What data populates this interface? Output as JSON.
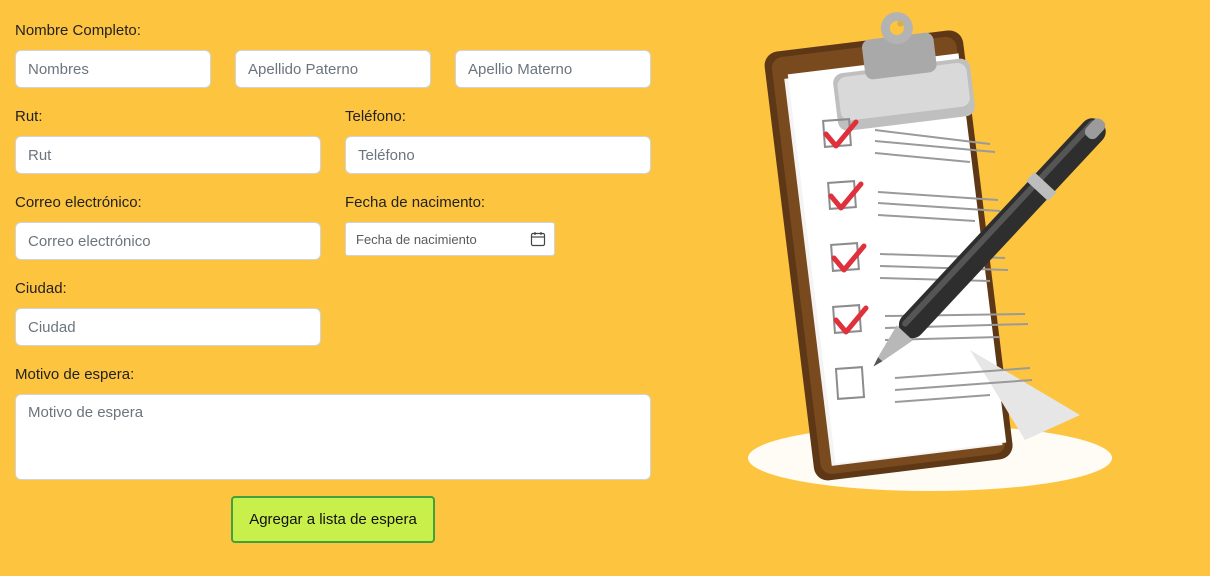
{
  "form": {
    "nombre_label": "Nombre Completo:",
    "nombres_placeholder": "Nombres",
    "apellido_paterno_placeholder": "Apellido Paterno",
    "apellido_materno_placeholder": "Apellio Materno",
    "rut_label": "Rut:",
    "rut_placeholder": "Rut",
    "telefono_label": "Teléfono:",
    "telefono_placeholder": "Teléfono",
    "correo_label": "Correo electrónico:",
    "correo_placeholder": "Correo electrónico",
    "fecha_label": "Fecha de nacimento:",
    "fecha_placeholder": "Fecha de nacimiento",
    "ciudad_label": "Ciudad:",
    "ciudad_placeholder": "Ciudad",
    "motivo_label": "Motivo de espera:",
    "motivo_placeholder": "Motivo de espera",
    "submit_label": "Agregar a lista de espera"
  },
  "icons": {
    "calendar": "calendar-icon",
    "illustration": "clipboard-checklist-illustration"
  },
  "colors": {
    "background": "#fdc43f",
    "button_fill": "#c8ef4a",
    "button_border": "#3ea33c",
    "check_mark": "#e0303b"
  }
}
